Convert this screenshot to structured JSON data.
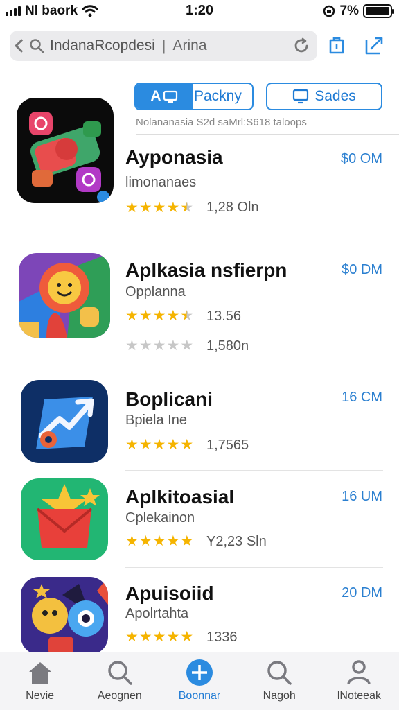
{
  "status_bar": {
    "carrier": "Nl baork",
    "time": "1:20",
    "battery_percent": "7%"
  },
  "search": {
    "query": "IndanaRcopdesi",
    "separator": "|",
    "filter": "Arina"
  },
  "segments": {
    "a_active": "A",
    "a_rest": "Packny",
    "b_label": "Sades"
  },
  "subheading": "Nolananasia S2d saMrl:S618 taloops",
  "apps": [
    {
      "name": "Ayponasia",
      "developer": "limonanaes",
      "price": "$0 OM",
      "rating_stars": 4.5,
      "rating_count": "1,28 Oln"
    },
    {
      "name": "Aplkasia nsfierpn",
      "developer": "Opplanna",
      "price": "$0 DM",
      "rating_stars": 4.5,
      "rating_count": "13.56",
      "secondary_count": "1,580n",
      "secondary_stars": 0
    },
    {
      "name": "Boplicani",
      "developer": "Bpiela Ine",
      "price": "16 CM",
      "rating_stars": 5,
      "rating_count": "1,7565"
    },
    {
      "name": "Aplkitoasial",
      "developer": "Cplekainon",
      "price": "16 UM",
      "rating_stars": 5,
      "rating_count": "Y2,23 Sln"
    },
    {
      "name": "Apuisoiid",
      "developer": "Apolrtahta",
      "price": "20 DM",
      "rating_stars": 5,
      "rating_count": "1336"
    }
  ],
  "tabbar": [
    {
      "label": "Nevie",
      "icon": "home-icon"
    },
    {
      "label": "Aeognen",
      "icon": "search-icon"
    },
    {
      "label": "Boonnar",
      "icon": "plus-circle-icon",
      "active": true
    },
    {
      "label": "Nagoh",
      "icon": "magnifier-icon"
    },
    {
      "label": "lNoteeak",
      "icon": "person-icon"
    }
  ],
  "colors": {
    "accent": "#2b8be0",
    "star": "#f5b400",
    "price": "#2a7fd0"
  }
}
